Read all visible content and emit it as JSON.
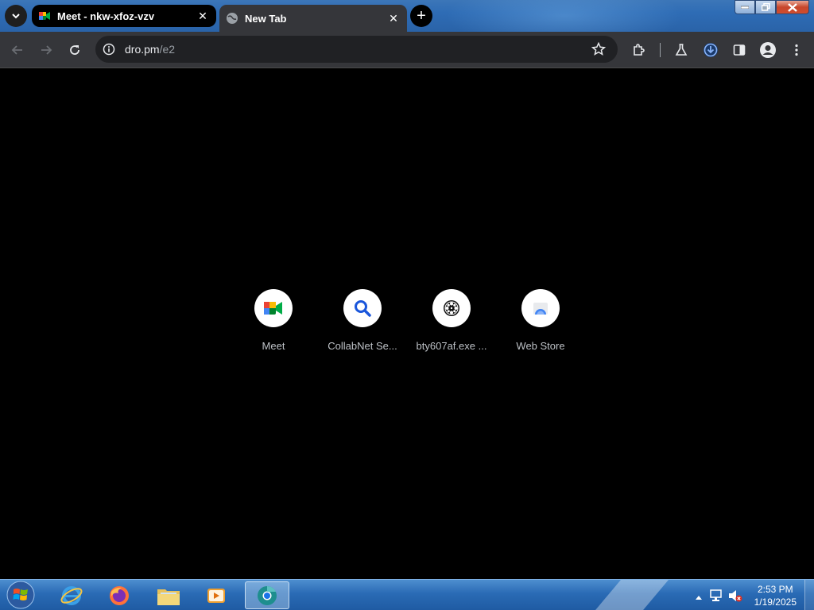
{
  "browser": {
    "tabs": [
      {
        "title": "Meet - nkw-xfoz-vzv",
        "active": false,
        "icon": "google-meet-icon"
      },
      {
        "title": "New Tab",
        "active": true,
        "icon": "globe-icon"
      }
    ],
    "address": {
      "host": "dro.pm",
      "path": "/e2"
    }
  },
  "shortcuts": [
    {
      "label": "Meet",
      "icon": "google-meet-icon"
    },
    {
      "label": "CollabNet Se...",
      "icon": "search-icon"
    },
    {
      "label": "bty607af.exe ...",
      "icon": "film-reel-icon"
    },
    {
      "label": "Web Store",
      "icon": "web-store-icon"
    }
  ],
  "taskbar": {
    "apps": [
      "internet-explorer-icon",
      "firefox-icon",
      "file-explorer-icon",
      "media-player-icon",
      "chrome-dev-icon"
    ],
    "clock": {
      "time": "2:53 PM",
      "date": "1/19/2025"
    }
  },
  "colors": {
    "toolbar": "#35363a",
    "content_bg": "#000000",
    "accent_blue": "#8ab4f8"
  }
}
